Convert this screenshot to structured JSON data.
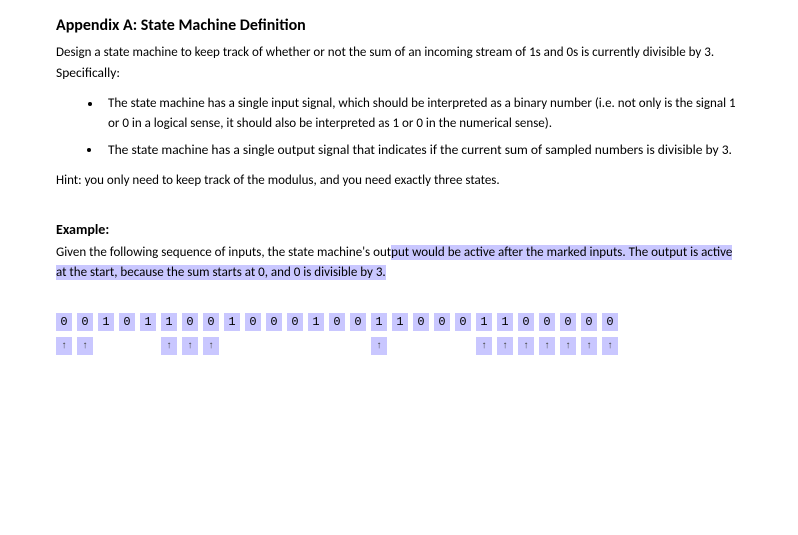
{
  "title": "Appendix A: State Machine Definition",
  "intro_part1": "Design a state machine to keep track of whether or not the sum of an incoming stream of 1s and 0s is currently divisible by 3. ",
  "intro_part2_spec": "Specifically:",
  "bullets": [
    "The state machine has a single input signal, which should be interpreted as a binary number (i.e. not only is the signal 1 or 0 in a logical sense, it should also be interpreted as 1 or 0 in the numerical sense).",
    "The state machine has a single output signal that indicates if the current sum of sampled numbers is divisible by 3."
  ],
  "hint": "Hint: you only need to keep track of the modulus, and you need exactly three states.",
  "example_heading": "Example:",
  "example_text_plain": "Given the following sequence of inputs, the state machine's out",
  "example_text_hl1": "put would be active after the marked ",
  "example_text_hl2": "inputs.  The output is active at the start, because the sum starts at 0, and 0 is divisible by 3.",
  "trailing_space_hl": "  ",
  "sequence": {
    "inputs": [
      "0",
      "0",
      "1",
      "0",
      "1",
      "1",
      "0",
      "0",
      "1",
      "0",
      "0",
      "0",
      "1",
      "0",
      "0",
      "1",
      "1",
      "0",
      "0",
      "0",
      "1",
      "1",
      "0",
      "0",
      "0",
      "0",
      "0"
    ],
    "marks": [
      true,
      true,
      false,
      false,
      false,
      true,
      true,
      true,
      false,
      false,
      false,
      false,
      false,
      false,
      false,
      true,
      false,
      false,
      false,
      false,
      true,
      true,
      true,
      true,
      true,
      true,
      true
    ]
  }
}
